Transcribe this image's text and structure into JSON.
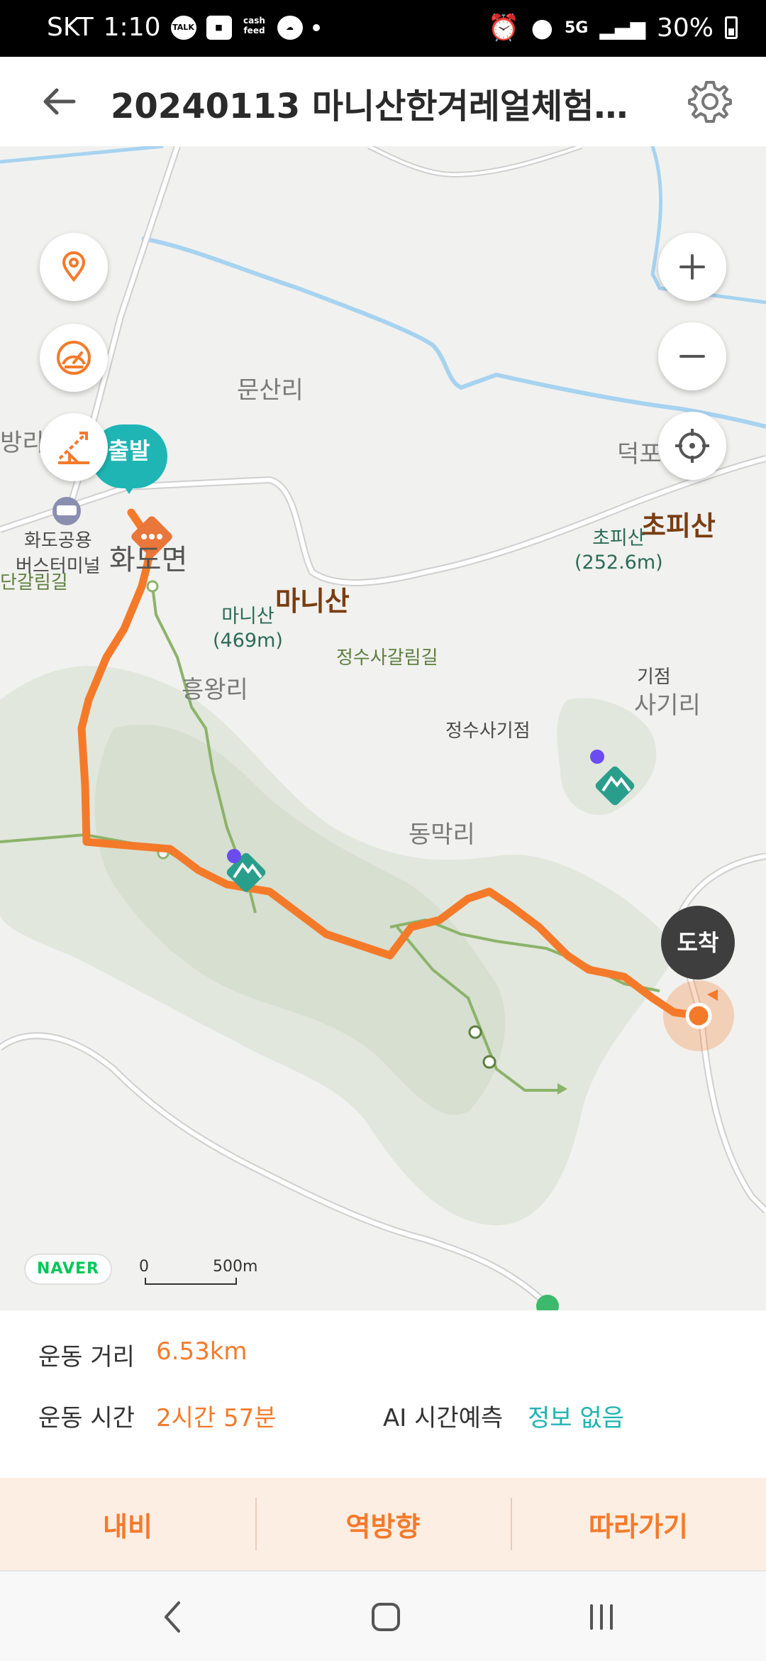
{
  "status_bar": {
    "carrier": "SKT",
    "time": "1:10",
    "network": "5G",
    "battery": "30%",
    "icons": [
      "talk-icon",
      "gallery-icon",
      "cashfeed-icon",
      "weather-icon",
      "alarm-icon",
      "location-icon",
      "5g-icon",
      "signal-icon",
      "battery-icon"
    ]
  },
  "header": {
    "title": "20240113 마니산한겨레얼체험관-...",
    "back_icon": "arrow-left-icon",
    "settings_icon": "gear-icon"
  },
  "map": {
    "start_label": "출발",
    "end_label": "도착",
    "places": {
      "bus_terminal": "화도공용\n버스터미널",
      "munsanri": "문산리",
      "bangri": "방리",
      "deokpori": "덕포리",
      "hwadomyeon": "화도면",
      "dangalrimgil": "단갈림길",
      "heungwangri": "흥왕리",
      "sagiri": "사기리",
      "dongmakri": "동막리",
      "jeongsusa_junction": "정수사갈림길",
      "jeongsusa_start": "정수사기점",
      "gijeom": "기점"
    },
    "peaks": [
      {
        "name": "마니산",
        "label": "마니산",
        "altitude": "(469m)"
      },
      {
        "name": "초피산",
        "label": "초피산",
        "altitude": "(252.6m)"
      }
    ],
    "controls": {
      "left": [
        "location-pin-icon",
        "speedometer-icon",
        "elevation-icon"
      ],
      "right": [
        "zoom-in-icon",
        "zoom-out-icon",
        "crosshair-icon"
      ]
    },
    "naver_logo": "NAVER",
    "scale_zero": "0",
    "scale_length": "500m",
    "colors": {
      "route": "#f47a2a",
      "trail": "#8cb36a",
      "water": "#a6d3f0",
      "mountain": "#dfe6da",
      "start": "#1fb5b5",
      "end": "#3e3e3e"
    }
  },
  "info": {
    "distance_label": "운동 거리",
    "distance_value": "6.53km",
    "time_label": "운동 시간",
    "time_value": "2시간 57분",
    "ai_label": "AI 시간예측",
    "ai_value": "정보 없음"
  },
  "actions": {
    "navi": "내비",
    "reverse": "역방향",
    "follow": "따라가기"
  },
  "nav_bar": [
    "back-nav-icon",
    "home-nav-icon",
    "recents-nav-icon"
  ]
}
